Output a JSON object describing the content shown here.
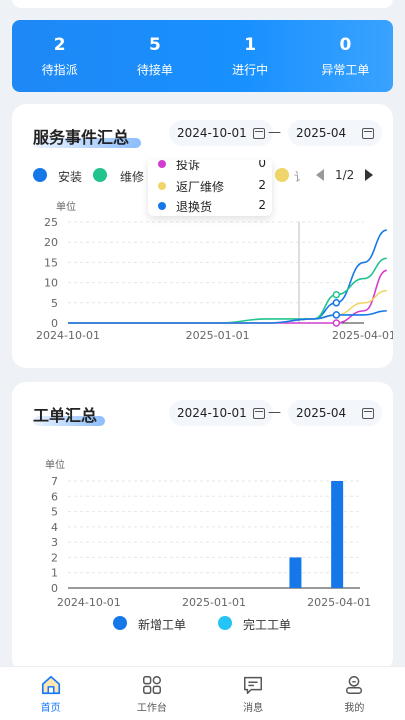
{
  "stats": [
    {
      "value": "2",
      "label": "待指派"
    },
    {
      "value": "5",
      "label": "待接单"
    },
    {
      "value": "1",
      "label": "进行中"
    },
    {
      "value": "0",
      "label": "异常工单"
    }
  ],
  "service": {
    "title": "服务事件汇总",
    "date_start": "2024-10-01",
    "date_end": "2025-04",
    "separator": "—",
    "legend": [
      {
        "name": "安装",
        "color": "#1677e8"
      },
      {
        "name": "维修",
        "color": "#22c38e"
      },
      {
        "name": "",
        "color": "#f0d66a"
      }
    ],
    "legend_partial": "讠",
    "pager": "1/2",
    "tooltip": [
      {
        "name": "投诉",
        "value": "0",
        "color": "#d23dd0"
      },
      {
        "name": "返厂维修",
        "value": "2",
        "color": "#f0d66a"
      },
      {
        "name": "退换货",
        "value": "2",
        "color": "#1677e8"
      }
    ]
  },
  "workorder": {
    "title": "工单汇总",
    "date_start": "2024-10-01",
    "date_end": "2025-04",
    "separator": "—",
    "legend": [
      {
        "name": "新增工单",
        "color": "#1677e8"
      },
      {
        "name": "完工工单",
        "color": "#26c3f5"
      }
    ]
  },
  "chart_data": [
    {
      "type": "line",
      "ylabel": "单位",
      "ylim": [
        0,
        25
      ],
      "yticks": [
        "0",
        "5",
        "10",
        "15",
        "20",
        "25"
      ],
      "xticks": [
        "2024-10-01",
        "2025-01-01",
        "2025-04-01"
      ],
      "grid": true,
      "x": [
        "2024-10-01",
        "2024-11-01",
        "2024-12-01",
        "2025-01-01",
        "2025-02-01",
        "2025-03-01",
        "2025-03-15",
        "2025-04-01",
        "2025-04-15"
      ],
      "series": [
        {
          "name": "安装",
          "color": "#1677e8",
          "values": [
            0,
            0,
            0,
            0,
            0,
            1,
            5,
            15,
            23
          ]
        },
        {
          "name": "维修",
          "color": "#22c38e",
          "values": [
            0,
            0,
            0,
            0,
            1,
            1,
            7,
            11,
            16
          ]
        },
        {
          "name": "投诉",
          "color": "#d23dd0",
          "values": [
            0,
            0,
            0,
            0,
            0,
            0,
            0,
            3,
            13
          ]
        },
        {
          "name": "返厂维修",
          "color": "#f0d66a",
          "values": [
            0,
            0,
            0,
            0,
            0,
            1,
            2,
            5,
            8
          ]
        },
        {
          "name": "退换货",
          "color": "#1677e8",
          "values": [
            0,
            0,
            0,
            0,
            0,
            1,
            2,
            2,
            3
          ]
        }
      ]
    },
    {
      "type": "bar",
      "ylabel": "单位",
      "ylim": [
        0,
        7
      ],
      "yticks": [
        "0",
        "1",
        "2",
        "3",
        "4",
        "5",
        "6",
        "7"
      ],
      "xticks": [
        "2024-10-01",
        "2025-01-01",
        "2025-04-01"
      ],
      "grid": true,
      "categories": [
        "2024-10",
        "2024-11",
        "2024-12",
        "2025-01",
        "2025-02",
        "2025-03",
        "2025-04"
      ],
      "series": [
        {
          "name": "新增工单",
          "color": "#1677e8",
          "values": [
            0,
            0,
            0,
            0,
            0,
            2,
            7
          ]
        },
        {
          "name": "完工工单",
          "color": "#26c3f5",
          "values": [
            0,
            0,
            0,
            0,
            0,
            0,
            0
          ]
        }
      ]
    }
  ],
  "tabs": [
    {
      "label": "首页",
      "icon": "home-icon",
      "active": true
    },
    {
      "label": "工作台",
      "icon": "grid-icon",
      "active": false
    },
    {
      "label": "消息",
      "icon": "message-icon",
      "active": false
    },
    {
      "label": "我的",
      "icon": "user-icon",
      "active": false
    }
  ]
}
